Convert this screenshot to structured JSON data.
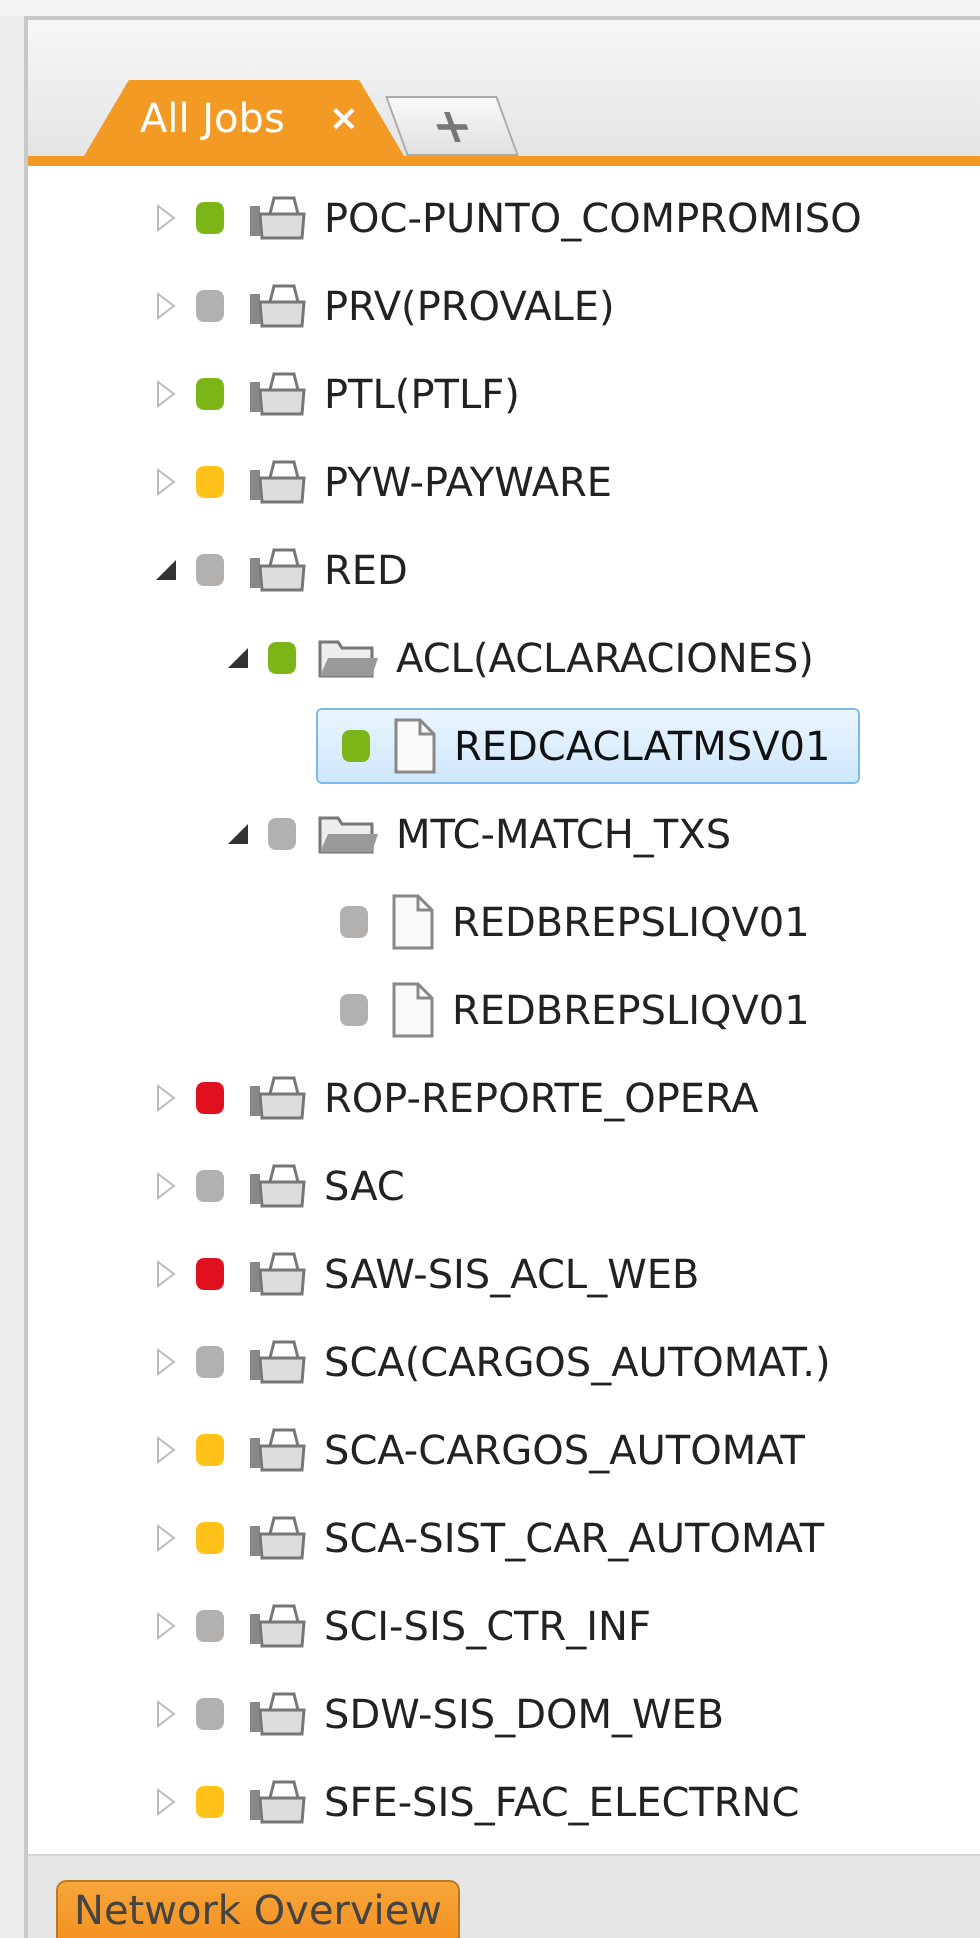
{
  "tabs": [
    {
      "label": "All Jobs",
      "close": "×",
      "selected": true
    }
  ],
  "add_tab": {
    "label": "+"
  },
  "tree": [
    {
      "kind": "app",
      "name": "POC-PUNTO_COMPROMISO",
      "color": "#7cb518",
      "expanded": false,
      "selected": false
    },
    {
      "kind": "app",
      "name": "PRV(PROVALE)",
      "color": "#b3b0b0",
      "expanded": false,
      "selected": false
    },
    {
      "kind": "app",
      "name": "PTL(PTLF)",
      "color": "#7cb518",
      "expanded": false,
      "selected": false
    },
    {
      "kind": "app",
      "name": "PYW-PAYWARE",
      "color": "#ffc21a",
      "expanded": false,
      "selected": false
    },
    {
      "kind": "app",
      "name": "RED",
      "color": "#b3b0b0",
      "expanded": true,
      "selected": false,
      "children": [
        {
          "kind": "folder",
          "name": "ACL(ACLARACIONES)",
          "color": "#7cb518",
          "expanded": true,
          "selected": false,
          "children": [
            {
              "kind": "job",
              "name": "REDCACLATMSV01",
              "color": "#7cb518",
              "selected": true
            }
          ]
        },
        {
          "kind": "folder",
          "name": "MTC-MATCH_TXS",
          "color": "#b3b0b0",
          "expanded": true,
          "selected": false,
          "children": [
            {
              "kind": "job",
              "name": "REDBREPSLIQV01",
              "color": "#b3b0b0",
              "selected": false
            },
            {
              "kind": "job",
              "name": "REDBREPSLIQV01",
              "color": "#b3b0b0",
              "selected": false
            }
          ]
        }
      ]
    },
    {
      "kind": "app",
      "name": "ROP-REPORTE_OPERA",
      "color": "#e0101f",
      "expanded": false,
      "selected": false
    },
    {
      "kind": "app",
      "name": "SAC",
      "color": "#b3b0b0",
      "expanded": false,
      "selected": false
    },
    {
      "kind": "app",
      "name": "SAW-SIS_ACL_WEB",
      "color": "#e0101f",
      "expanded": false,
      "selected": false
    },
    {
      "kind": "app",
      "name": "SCA(CARGOS_AUTOMAT.)",
      "color": "#b3b0b0",
      "expanded": false,
      "selected": false
    },
    {
      "kind": "app",
      "name": "SCA-CARGOS_AUTOMAT",
      "color": "#ffc21a",
      "expanded": false,
      "selected": false
    },
    {
      "kind": "app",
      "name": "SCA-SIST_CAR_AUTOMAT",
      "color": "#ffc21a",
      "expanded": false,
      "selected": false
    },
    {
      "kind": "app",
      "name": "SCI-SIS_CTR_INF",
      "color": "#b3b0b0",
      "expanded": false,
      "selected": false
    },
    {
      "kind": "app",
      "name": "SDW-SIS_DOM_WEB",
      "color": "#b3b0b0",
      "expanded": false,
      "selected": false
    },
    {
      "kind": "app",
      "name": "SFE-SIS_FAC_ELECTRNC",
      "color": "#ffc21a",
      "expanded": false,
      "selected": false
    }
  ],
  "footer": {
    "button": "Network Overview"
  }
}
